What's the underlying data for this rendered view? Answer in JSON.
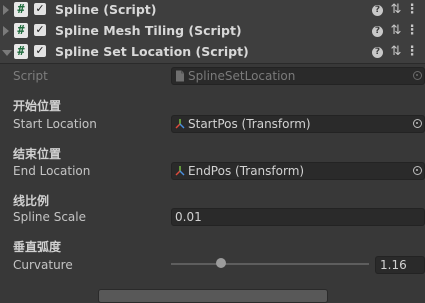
{
  "components": [
    {
      "title": "Spline (Script)",
      "enabled": true,
      "expanded": false
    },
    {
      "title": "Spline Mesh Tiling (Script)",
      "enabled": true,
      "expanded": false
    },
    {
      "title": "Spline Set Location (Script)",
      "enabled": true,
      "expanded": true
    }
  ],
  "header_icons": {
    "script": "#",
    "check": "✓",
    "help": "?",
    "preset": "⇅",
    "menu": "⋮"
  },
  "fields": {
    "script": {
      "label": "Script",
      "value": "SplineSetLocation"
    },
    "start": {
      "heading": "开始位置",
      "label": "Start Location",
      "value": "StartPos (Transform)"
    },
    "end": {
      "heading": "结束位置",
      "label": "End Location",
      "value": "EndPos (Transform)"
    },
    "scale": {
      "heading": "线比例",
      "label": "Spline Scale",
      "value": "0.01"
    },
    "curvature": {
      "heading": "垂直弧度",
      "label": "Curvature",
      "value": "1.16",
      "slider_fraction": 0.25
    }
  },
  "colors": {
    "background": "#383838",
    "header": "#3e3e3e",
    "field": "#2a2a2a",
    "script_icon_fg": "#1f6b3d"
  }
}
